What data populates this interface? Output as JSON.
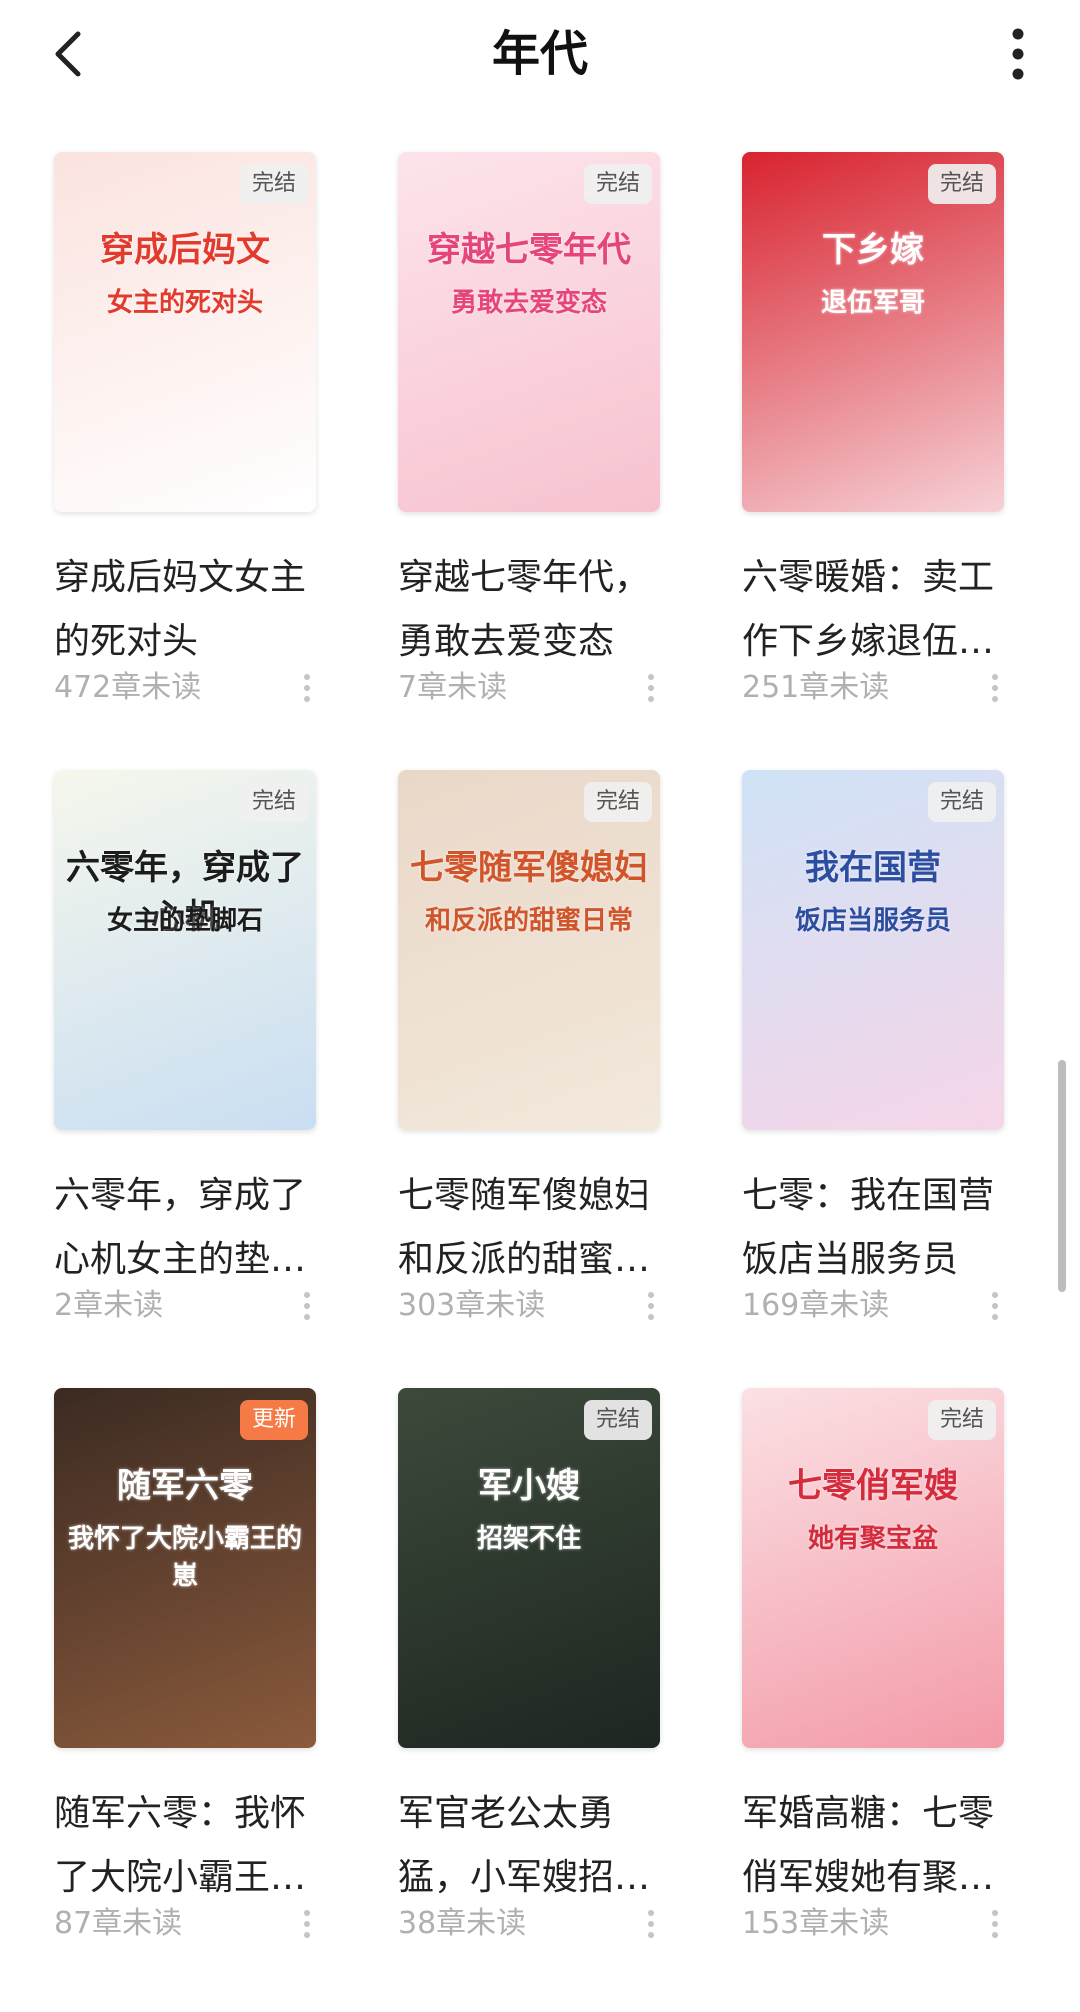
{
  "header": {
    "title": "年代"
  },
  "books": [
    {
      "title": "穿成后妈文女主的死对头",
      "unread": "472章未读",
      "badge": "完结",
      "cover_text": [
        "穿成后妈文",
        "女主的死对头"
      ],
      "cover_colors": [
        "#fbe3df",
        "#ffffff"
      ],
      "accent": "#e23b2e"
    },
    {
      "title": "穿越七零年代，勇敢去爱变态",
      "unread": "7章未读",
      "badge": "完结",
      "cover_text": [
        "穿越七零年代",
        "勇敢去爱变态"
      ],
      "cover_colors": [
        "#fde4ea",
        "#f7c2cf"
      ],
      "accent": "#e5457a"
    },
    {
      "title": "六零暖婚：卖工作下乡嫁退伍军哥",
      "unread": "251章未读",
      "badge": "完结",
      "cover_text": [
        "下乡嫁",
        "退伍军哥"
      ],
      "cover_colors": [
        "#d8232f",
        "#f6d1d6"
      ],
      "accent": "#ffffff"
    },
    {
      "title": "六零年，穿成了心机女主的垫脚石",
      "unread": "2章未读",
      "badge": "完结",
      "cover_text": [
        "六零年，穿成了心机",
        "女主的垫脚石"
      ],
      "cover_colors": [
        "#f5f7ec",
        "#c9def2"
      ],
      "accent": "#1c1c1c"
    },
    {
      "title": "七零随军傻媳妇和反派的甜蜜日常",
      "unread": "303章未读",
      "badge": "完结",
      "cover_text": [
        "七零随军傻媳妇",
        "和反派的甜蜜日常"
      ],
      "cover_colors": [
        "#e9d8c8",
        "#f3e8dc"
      ],
      "accent": "#d1542b"
    },
    {
      "title": "七零：我在国营饭店当服务员",
      "unread": "169章未读",
      "badge": "完结",
      "cover_text": [
        "我在国营",
        "饭店当服务员"
      ],
      "cover_colors": [
        "#cfe2f7",
        "#f6d6e8"
      ],
      "accent": "#2b4ea0"
    },
    {
      "title": "随军六零：我怀了大院小霸王的崽",
      "unread": "87章未读",
      "badge": "更新",
      "cover_text": [
        "随军六零",
        "我怀了大院小霸王的崽"
      ],
      "cover_colors": [
        "#3b2a22",
        "#8b5a3c"
      ],
      "accent": "#ffffff"
    },
    {
      "title": "军官老公太勇猛，小军嫂招架不住",
      "unread": "38章未读",
      "badge": "完结",
      "cover_text": [
        "军小嫂",
        "招架不住"
      ],
      "cover_colors": [
        "#3c4a3b",
        "#1e2620"
      ],
      "accent": "#ffffff"
    },
    {
      "title": "军婚高糖：七零俏军嫂她有聚宝盆",
      "unread": "153章未读",
      "badge": "完结",
      "cover_text": [
        "七零俏军嫂",
        "她有聚宝盆"
      ],
      "cover_colors": [
        "#fbe1e4",
        "#f39aa8"
      ],
      "accent": "#d42c3c"
    }
  ]
}
